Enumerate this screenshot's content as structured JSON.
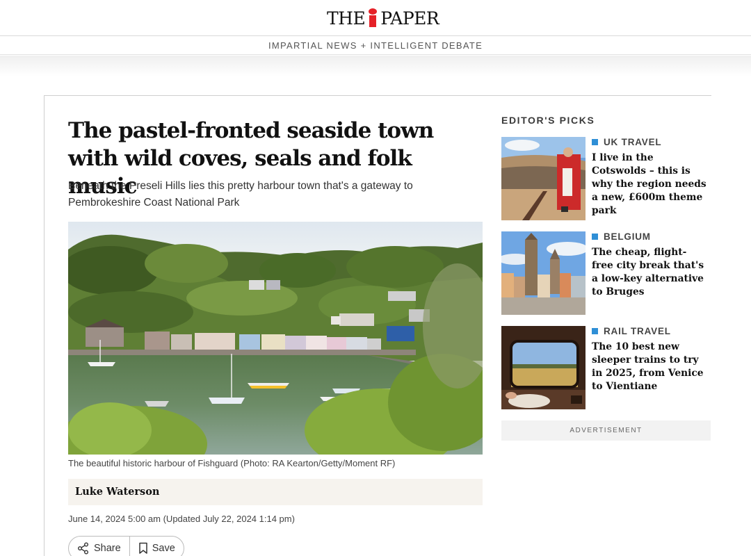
{
  "header": {
    "logo_prefix": "THE",
    "logo_suffix": "PAPER",
    "tagline": "IMPARTIAL NEWS + INTELLIGENT DEBATE"
  },
  "article": {
    "headline": "The pastel-fronted seaside town with wild coves, seals and folk music",
    "standfirst": "Beneath the Preseli Hills lies this pretty harbour town that's a gateway to Pembrokeshire Coast National Park",
    "caption": "The beautiful historic harbour of Fishguard (Photo: RA Kearton/Getty/Moment RF)",
    "author": "Luke Waterson",
    "dateline": "June 14, 2024 5:00 am (Updated July 22, 2024 1:14 pm)",
    "actions": {
      "share_label": "Share",
      "save_label": "Save"
    }
  },
  "sidebar": {
    "title": "EDITOR'S PICKS",
    "picks": [
      {
        "category": "UK TRAVEL",
        "title": "I live in the Cotswolds – this is why the region needs a new, £600m theme park",
        "icon": "amphitheatre-photo"
      },
      {
        "category": "BELGIUM",
        "title": "The cheap, flight-free city break that's a low-key alternative to Bruges",
        "icon": "belgian-square-photo"
      },
      {
        "category": "RAIL TRAVEL",
        "title": "The 10 best new sleeper trains to try in 2025, from Venice to Vientiane",
        "icon": "train-window-photo"
      }
    ],
    "advert_label": "ADVERTISEMENT"
  },
  "colors": {
    "brand_red": "#e52128",
    "category_blue": "#2f8fd6",
    "byline_bg": "#f6f3ee"
  }
}
